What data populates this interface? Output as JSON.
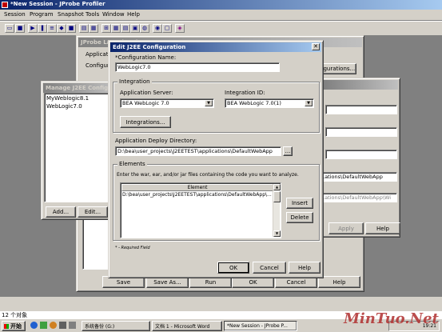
{
  "app": {
    "title": "*New Session - JProbe Profiler",
    "menu": [
      "Session",
      "Program",
      "Snapshot",
      "Tools",
      "Window",
      "Help"
    ],
    "status_text": "12 个对象"
  },
  "launchpad": {
    "title": "JProbe Launchpad",
    "applicatio_label": "Applicatio",
    "configur_label": "Configur",
    "configurations_button": "...gurations...",
    "buttons": [
      "Save",
      "Save As...",
      "Run",
      "OK",
      "Cancel",
      "Help"
    ]
  },
  "right_panel": {
    "path1": "...ations\\DefaultWebApp",
    "path2": "...ations\\DefaultWebApp\\Wi",
    "apply": "Apply",
    "help": "Help"
  },
  "manage": {
    "title": "Manage J2EE Configurations",
    "items": [
      "MyWeblogic8.1",
      "WebLogic7.0"
    ],
    "add": "Add...",
    "edit": "Edit..."
  },
  "edit_dialog": {
    "title": "Edit J2EE Configuration",
    "config_name_label": "*Configuration Name:",
    "config_name_value": "WebLogic7.0",
    "integration_group": "Integration",
    "app_server_label": "Application Server:",
    "app_server_value": "BEA WebLogic 7.0",
    "integration_id_label": "Integration ID:",
    "integration_id_value": "BEA WebLogic 7.0(1)",
    "integrations_button": "Integrations...",
    "deploy_dir_label": "Application Deploy Directory:",
    "deploy_dir_value": "D:\\bea\\user_projects\\J2EETEST\\applications\\DefaultWebApp",
    "browse_button": "...",
    "elements_group": "Elements",
    "elements_hint": "Enter the war, ear, and/or jar files containing the code you want to analyze.",
    "table_header": "Element",
    "table_rows": [
      "D:\\bea\\user_projects\\J2EETEST\\applications\\DefaultWebApp\\..."
    ],
    "insert_button": "Insert",
    "delete_button": "Delete",
    "required_note": "* - Required Field",
    "ok": "OK",
    "cancel": "Cancel",
    "help": "Help"
  },
  "taskbar": {
    "start": "开始",
    "tasks": [
      "系统备份 (G:)",
      "文档 1 - Microsoft Word",
      "*New Session - JProbe P..."
    ],
    "time": "19:21"
  },
  "watermark": "MinTuo.Net"
}
